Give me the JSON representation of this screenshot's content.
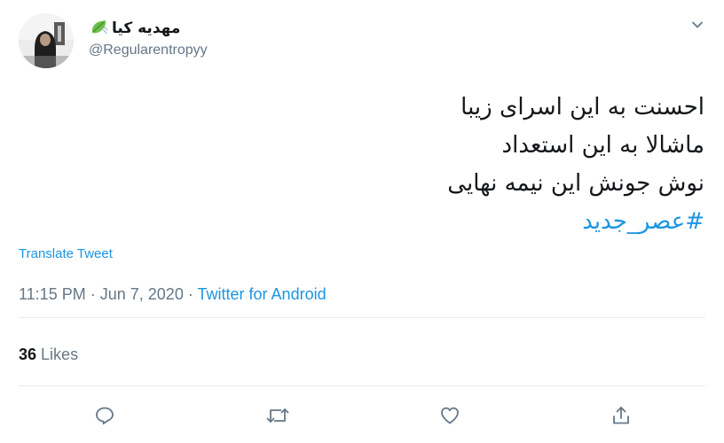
{
  "user": {
    "display_name": "مهدیه کیا",
    "emoji_icon": "leaf-fluttering-icon",
    "handle": "@Regularentropyy",
    "avatar_icon": "avatar"
  },
  "tweet": {
    "lines": [
      "احسنت به این اسرای زیبا",
      "ماشالا به این استعداد",
      "نوش جونش این نیمه نهایی"
    ],
    "hashtag": "#عصر_جدید"
  },
  "translate_label": "Translate Tweet",
  "meta": {
    "time": "11:15 PM",
    "separator": "·",
    "date": "Jun 7, 2020",
    "source": "Twitter for Android"
  },
  "stats": {
    "likes_count": "36",
    "likes_label": "Likes"
  },
  "actions": [
    "reply-icon",
    "retweet-icon",
    "like-icon",
    "share-icon"
  ],
  "colors": {
    "accent": "#1b95e0",
    "secondary_text": "#657786",
    "divider": "#e6ecf0",
    "text": "#14171a"
  }
}
